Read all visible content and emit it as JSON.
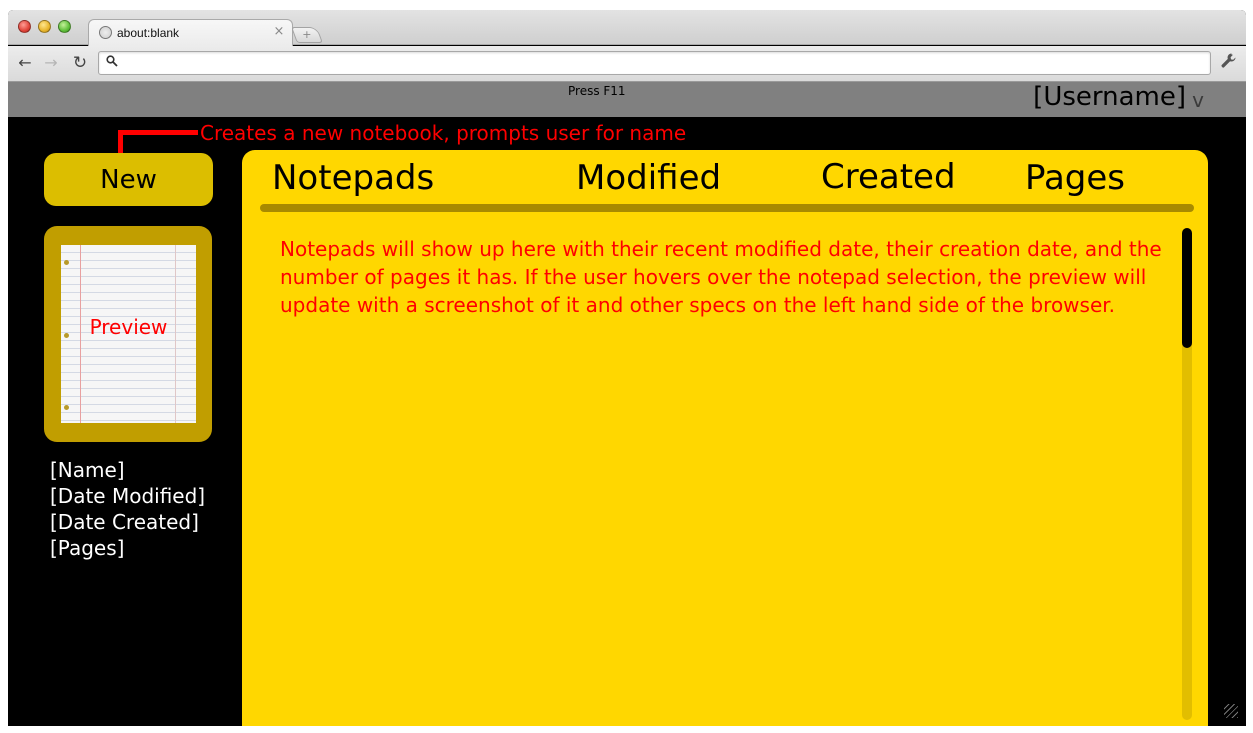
{
  "browser": {
    "tab_title": "about:blank",
    "tab_close": "×",
    "new_tab": "+",
    "url_value": ""
  },
  "icons": {
    "back": "arrow-left-icon",
    "forward": "arrow-right-icon",
    "reload": "reload-icon",
    "search": "search-icon",
    "wrench": "wrench-icon",
    "globe": "globe-icon"
  },
  "header": {
    "hint": "Press F11",
    "username": "[Username]",
    "chevron": "v"
  },
  "annotation": {
    "new_button_note": "Creates a new notebook, prompts user for name"
  },
  "sidebar": {
    "new_label": "New",
    "preview_label": "Preview",
    "meta": [
      "[Name]",
      "[Date Modified]",
      "[Date Created]",
      "[Pages]"
    ]
  },
  "list": {
    "columns": [
      "Notepads",
      "Modified",
      "Created",
      "Pages"
    ],
    "placeholder_text": "Notepads will show up here with their recent modified date, their creation date, and the number of pages it has.  If the user hovers over the notepad selection, the preview will update with a screenshot of it and other specs on the left hand side of the browser."
  },
  "colors": {
    "panel": "#ffd700",
    "new_button": "#dcbe00",
    "preview_frame": "#c19e00",
    "annotation": "#ff0000",
    "header_bar": "#808080",
    "background": "#000000"
  }
}
